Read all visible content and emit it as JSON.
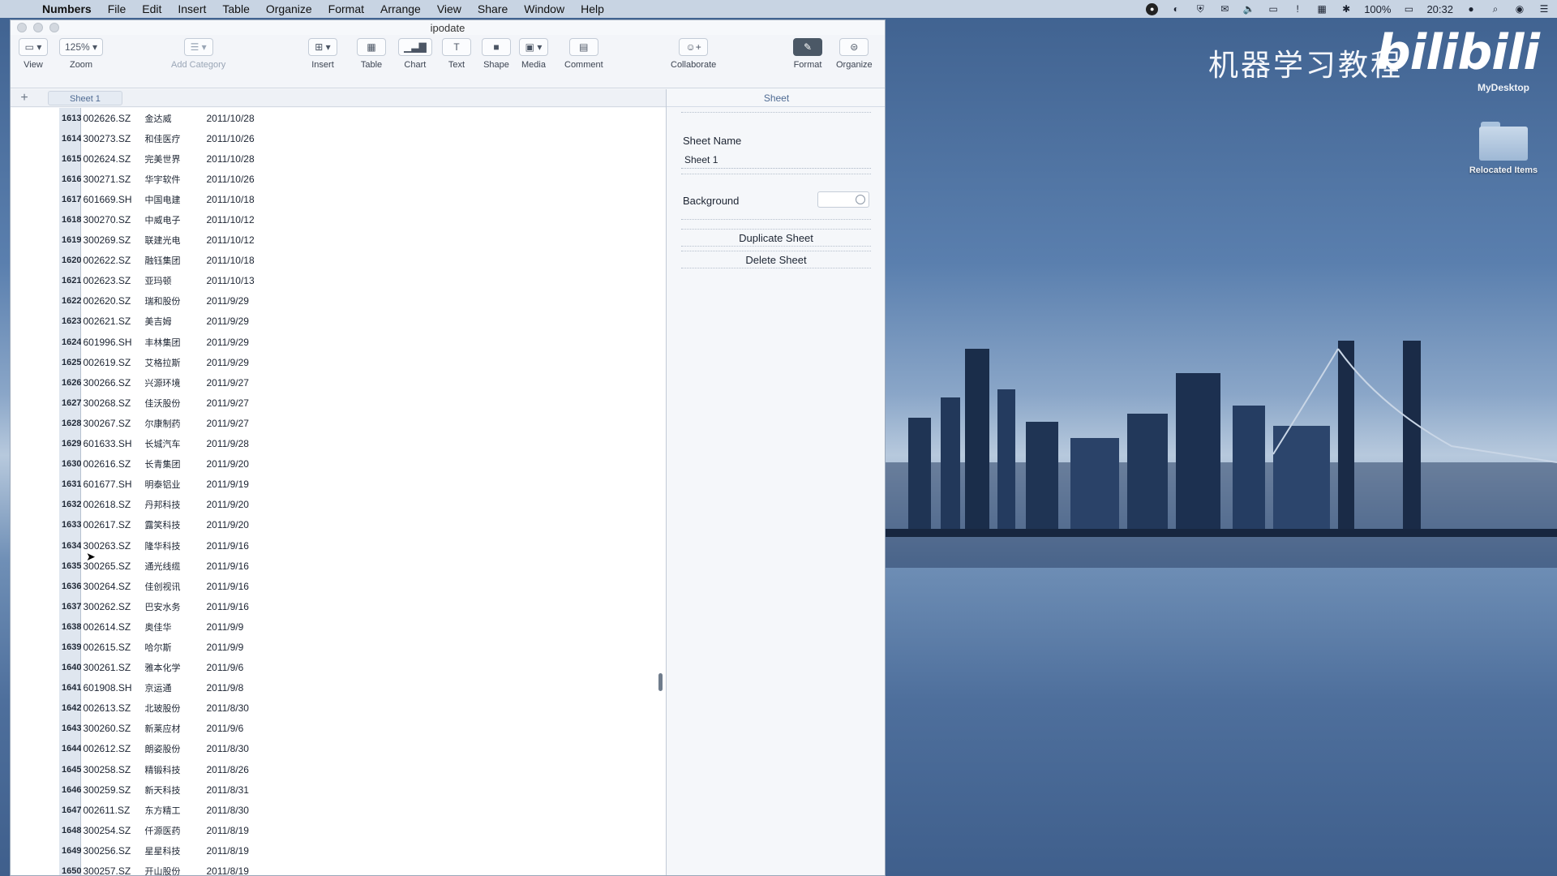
{
  "menubar": {
    "app": "Numbers",
    "items": [
      "File",
      "Edit",
      "Insert",
      "Table",
      "Organize",
      "Format",
      "Arrange",
      "View",
      "Share",
      "Window",
      "Help"
    ],
    "battery": "100%",
    "clock": "20:32"
  },
  "window": {
    "title": "ipodate"
  },
  "toolbar": {
    "view": "View",
    "zoom_value": "125%",
    "zoom": "Zoom",
    "add_category": "Add Category",
    "insert": "Insert",
    "table": "Table",
    "chart": "Chart",
    "text": "Text",
    "shape": "Shape",
    "media": "Media",
    "comment": "Comment",
    "collaborate": "Collaborate",
    "format": "Format",
    "organize": "Organize"
  },
  "sheets": {
    "add": "+",
    "active": "Sheet 1"
  },
  "rows": [
    {
      "n": "1613",
      "code": "002626.SZ",
      "name": "金达威",
      "date": "2011/10/28"
    },
    {
      "n": "1614",
      "code": "300273.SZ",
      "name": "和佳医疗",
      "date": "2011/10/26"
    },
    {
      "n": "1615",
      "code": "002624.SZ",
      "name": "完美世界",
      "date": "2011/10/28"
    },
    {
      "n": "1616",
      "code": "300271.SZ",
      "name": "华宇软件",
      "date": "2011/10/26"
    },
    {
      "n": "1617",
      "code": "601669.SH",
      "name": "中国电建",
      "date": "2011/10/18"
    },
    {
      "n": "1618",
      "code": "300270.SZ",
      "name": "中威电子",
      "date": "2011/10/12"
    },
    {
      "n": "1619",
      "code": "300269.SZ",
      "name": "联建光电",
      "date": "2011/10/12"
    },
    {
      "n": "1620",
      "code": "002622.SZ",
      "name": "融钰集团",
      "date": "2011/10/18"
    },
    {
      "n": "1621",
      "code": "002623.SZ",
      "name": "亚玛顿",
      "date": "2011/10/13"
    },
    {
      "n": "1622",
      "code": "002620.SZ",
      "name": "瑞和股份",
      "date": "2011/9/29"
    },
    {
      "n": "1623",
      "code": "002621.SZ",
      "name": "美吉姆",
      "date": "2011/9/29"
    },
    {
      "n": "1624",
      "code": "601996.SH",
      "name": "丰林集团",
      "date": "2011/9/29"
    },
    {
      "n": "1625",
      "code": "002619.SZ",
      "name": "艾格拉斯",
      "date": "2011/9/29"
    },
    {
      "n": "1626",
      "code": "300266.SZ",
      "name": "兴源环境",
      "date": "2011/9/27"
    },
    {
      "n": "1627",
      "code": "300268.SZ",
      "name": "佳沃股份",
      "date": "2011/9/27"
    },
    {
      "n": "1628",
      "code": "300267.SZ",
      "name": "尔康制药",
      "date": "2011/9/27"
    },
    {
      "n": "1629",
      "code": "601633.SH",
      "name": "长城汽车",
      "date": "2011/9/28"
    },
    {
      "n": "1630",
      "code": "002616.SZ",
      "name": "长青集团",
      "date": "2011/9/20"
    },
    {
      "n": "1631",
      "code": "601677.SH",
      "name": "明泰铝业",
      "date": "2011/9/19"
    },
    {
      "n": "1632",
      "code": "002618.SZ",
      "name": "丹邦科技",
      "date": "2011/9/20"
    },
    {
      "n": "1633",
      "code": "002617.SZ",
      "name": "露笑科技",
      "date": "2011/9/20"
    },
    {
      "n": "1634",
      "code": "300263.SZ",
      "name": "隆华科技",
      "date": "2011/9/16"
    },
    {
      "n": "1635",
      "code": "300265.SZ",
      "name": "通光线缆",
      "date": "2011/9/16"
    },
    {
      "n": "1636",
      "code": "300264.SZ",
      "name": "佳创视讯",
      "date": "2011/9/16"
    },
    {
      "n": "1637",
      "code": "300262.SZ",
      "name": "巴安水务",
      "date": "2011/9/16"
    },
    {
      "n": "1638",
      "code": "002614.SZ",
      "name": "奥佳华",
      "date": "2011/9/9"
    },
    {
      "n": "1639",
      "code": "002615.SZ",
      "name": "哈尔斯",
      "date": "2011/9/9"
    },
    {
      "n": "1640",
      "code": "300261.SZ",
      "name": "雅本化学",
      "date": "2011/9/6"
    },
    {
      "n": "1641",
      "code": "601908.SH",
      "name": "京运通",
      "date": "2011/9/8"
    },
    {
      "n": "1642",
      "code": "002613.SZ",
      "name": "北玻股份",
      "date": "2011/8/30"
    },
    {
      "n": "1643",
      "code": "300260.SZ",
      "name": "新莱应材",
      "date": "2011/9/6"
    },
    {
      "n": "1644",
      "code": "002612.SZ",
      "name": "朗姿股份",
      "date": "2011/8/30"
    },
    {
      "n": "1645",
      "code": "300258.SZ",
      "name": "精锻科技",
      "date": "2011/8/26"
    },
    {
      "n": "1646",
      "code": "300259.SZ",
      "name": "新天科技",
      "date": "2011/8/31"
    },
    {
      "n": "1647",
      "code": "002611.SZ",
      "name": "东方精工",
      "date": "2011/8/30"
    },
    {
      "n": "1648",
      "code": "300254.SZ",
      "name": "仟源医药",
      "date": "2011/8/19"
    },
    {
      "n": "1649",
      "code": "300256.SZ",
      "name": "星星科技",
      "date": "2011/8/19"
    },
    {
      "n": "1650",
      "code": "300257.SZ",
      "name": "开山股份",
      "date": "2011/8/19"
    }
  ],
  "inspector": {
    "tab": "Sheet",
    "sheet_name_label": "Sheet Name",
    "sheet_name_value": "Sheet 1",
    "background_label": "Background",
    "duplicate": "Duplicate Sheet",
    "delete": "Delete Sheet"
  },
  "desktop": {
    "brand_text": "机器学习教程",
    "brand_logo": "bilibili",
    "brand_sub": "MyDesktop",
    "folder_label": "Relocated Items"
  }
}
